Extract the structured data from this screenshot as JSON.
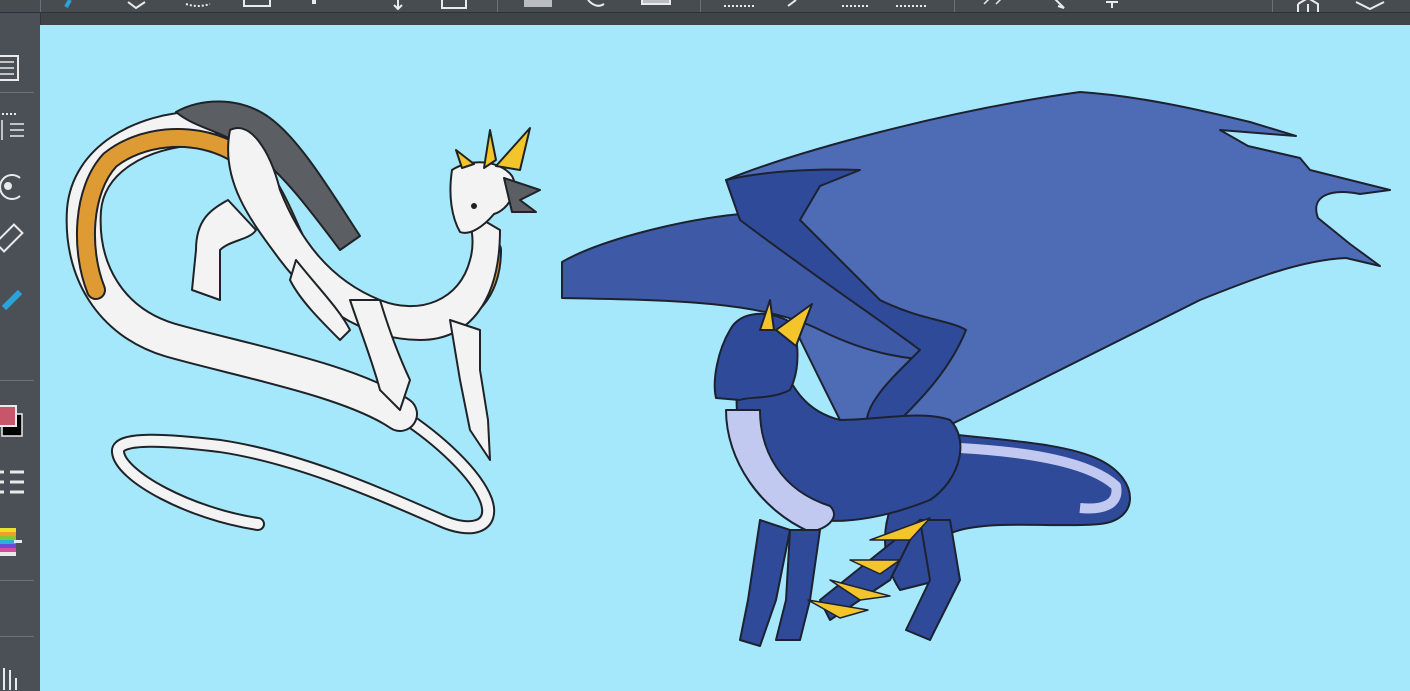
{
  "app": {
    "accent_color": "#2aa3d9",
    "canvas_color": "#a6e8fb",
    "primary_color_swatch": "#c9556b",
    "secondary_color_swatch": "#000000"
  },
  "top_toolbar": {
    "tools": [
      {
        "name": "brush-tool-icon"
      },
      {
        "name": "eraser-tool-icon"
      },
      {
        "name": "lasso-select-icon"
      },
      {
        "name": "rect-select-icon"
      },
      {
        "name": "pin-icon"
      },
      {
        "name": "move-icon"
      },
      {
        "name": "frame-icon"
      },
      {
        "name": "fill-color-icon"
      },
      {
        "name": "bucket-fill-icon"
      },
      {
        "name": "gradient-icon"
      },
      {
        "name": "guide-ruler-icon"
      },
      {
        "name": "eyedropper-icon"
      },
      {
        "name": "perspective-ruler-icon"
      },
      {
        "name": "symmetry-ruler-icon"
      },
      {
        "name": "transform-icon"
      },
      {
        "name": "select-arrow-icon"
      },
      {
        "name": "text-tool-icon"
      },
      {
        "name": "3d-model-icon"
      },
      {
        "name": "layers-stack-icon"
      }
    ]
  },
  "left_toolbar": {
    "tools": [
      {
        "name": "layers-panel-icon"
      },
      {
        "name": "layer-properties-icon"
      },
      {
        "name": "rotate-canvas-icon"
      },
      {
        "name": "ruler-icon"
      },
      {
        "name": "pen-tool-icon"
      },
      {
        "name": "color-swatch-icon"
      },
      {
        "name": "brush-list-icon"
      },
      {
        "name": "color-palette-icon"
      },
      {
        "name": "hand-tool-icon"
      }
    ]
  }
}
